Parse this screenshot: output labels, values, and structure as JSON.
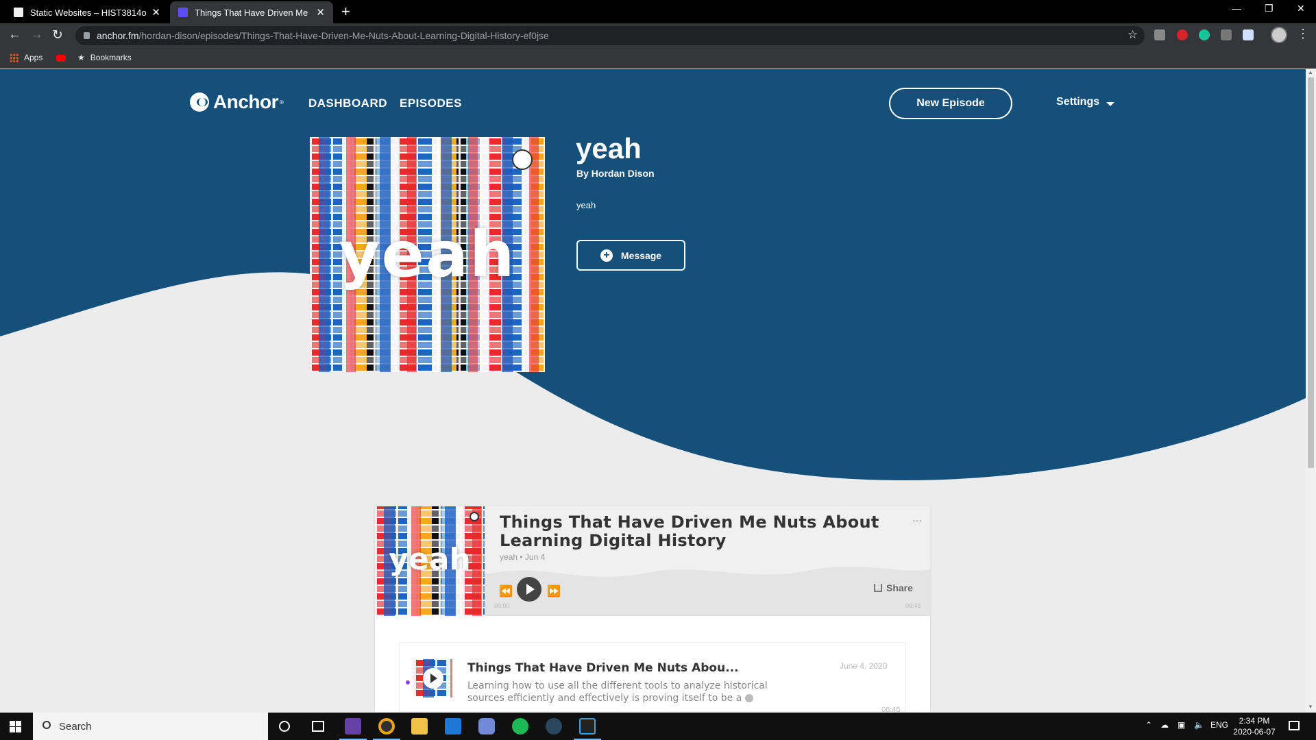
{
  "browser": {
    "tabs": [
      {
        "title": "Static Websites – HIST3814o",
        "active": false
      },
      {
        "title": "Things That Have Driven Me Nuts About Learning Digital History",
        "active": true
      }
    ],
    "new_tab": "+",
    "close": "✕",
    "url_host": "anchor.fm",
    "url_path": "/hordan-dison/episodes/Things-That-Have-Driven-Me-Nuts-About-Learning-Digital-History-ef0jse",
    "bookmarks": [
      {
        "label": "Apps",
        "icon": "apps-grid-icon"
      },
      {
        "label": "",
        "icon": "youtube-icon"
      },
      {
        "label": "Bookmarks",
        "icon": "star-icon"
      }
    ]
  },
  "colors": {
    "brand_blue": "#15507a",
    "page_bg": "#ececec",
    "accent_purple": "#8940fa"
  },
  "header": {
    "logo_text": "Anchor",
    "logo_mark": "®",
    "nav": [
      "DASHBOARD",
      "EPISODES"
    ],
    "new_episode": "New Episode",
    "settings": "Settings"
  },
  "podcast": {
    "cover_text": "yeah",
    "title": "yeah",
    "author": "By Hordan Dison",
    "description": "yeah",
    "message_button": "Message"
  },
  "player": {
    "title": "Things That Have Driven Me Nuts About Learning Digital History",
    "meta": "yeah • Jun 4",
    "more": "···",
    "share": "Share",
    "time_start": "00:00",
    "time_end": "06:46",
    "progress": 0
  },
  "episode_row": {
    "title": "Things That Have Driven Me Nuts Abou...",
    "description": "Learning how to use all the different tools to analyze historical sources efficiently and effectively is proving itself to be a",
    "date": "June 4, 2020",
    "duration": "06:46"
  },
  "taskbar": {
    "search": "Search",
    "lang": "ENG",
    "time": "2:34 PM",
    "date": "2020-06-07",
    "apps": [
      "twitch-icon",
      "chrome-icon",
      "file-explorer-icon",
      "mail-icon",
      "discord-icon",
      "spotify-icon",
      "steam-icon",
      "unity-icon"
    ]
  }
}
